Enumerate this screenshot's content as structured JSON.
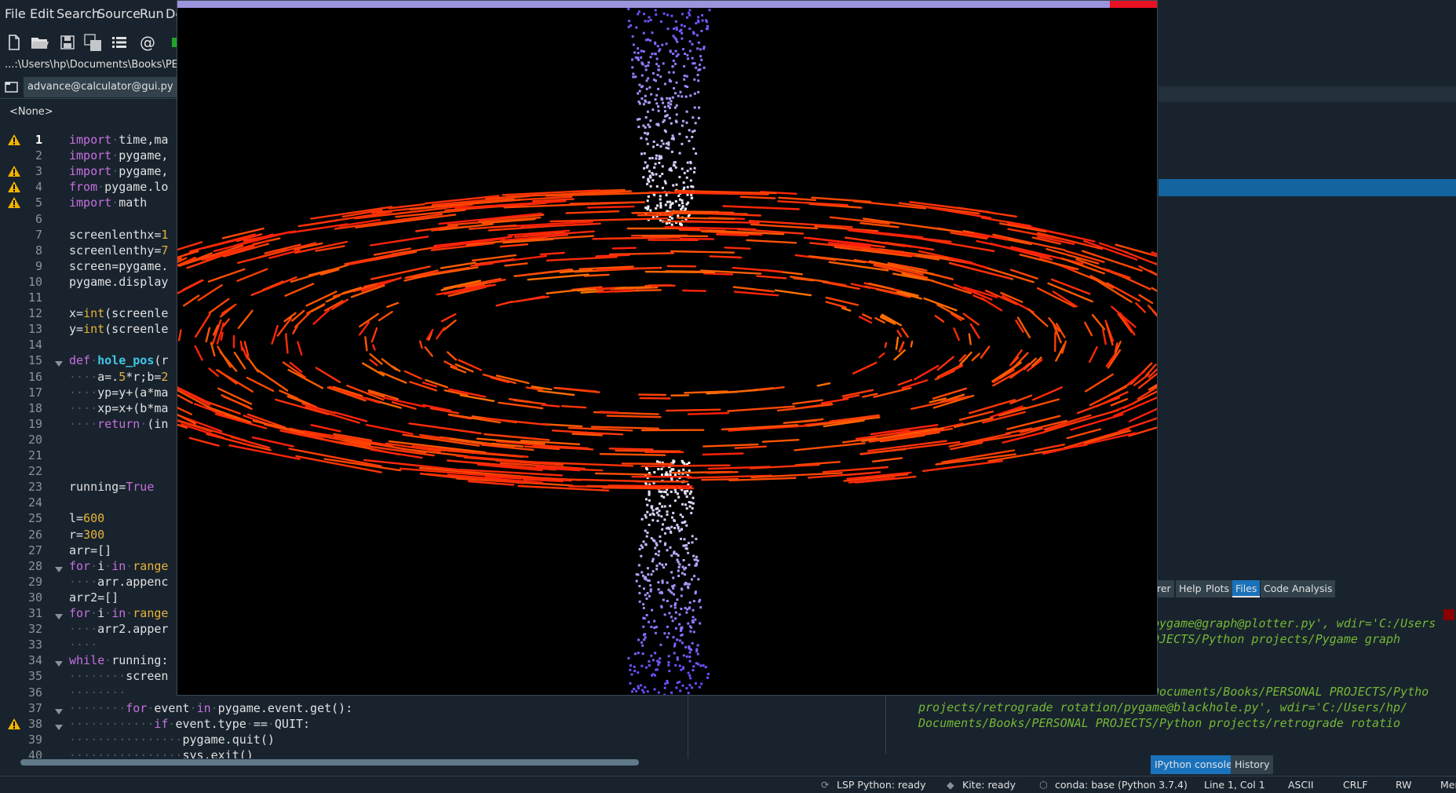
{
  "menu": [
    "File",
    "Edit",
    "Search",
    "Source",
    "Run",
    "De"
  ],
  "toolbar_icons": [
    "new-file-icon",
    "open-file-icon",
    "save-icon",
    "save-all-icon",
    "outline-icon",
    "email-icon",
    "run-icon"
  ],
  "path": "...:\\Users\\hp\\Documents\\Books\\PERSO",
  "editor": {
    "tab_name": "advance@calculator@gui.py",
    "tab_close": "✕",
    "class_selector": "<None>",
    "lines": [
      {
        "n": "1",
        "warn": true,
        "fold": false,
        "html": "<span class='kw'>import</span><span class='ws'>·</span>time,ma"
      },
      {
        "n": "2",
        "warn": false,
        "fold": false,
        "html": "<span class='kw'>import</span><span class='ws'>·</span>pygame,"
      },
      {
        "n": "3",
        "warn": true,
        "fold": false,
        "html": "<span class='kw'>import</span><span class='ws'>·</span>pygame,"
      },
      {
        "n": "4",
        "warn": true,
        "fold": false,
        "html": "<span class='kw'>from</span><span class='ws'>·</span>pygame.lo"
      },
      {
        "n": "5",
        "warn": true,
        "fold": false,
        "html": "<span class='kw'>import</span><span class='ws'>·</span>math"
      },
      {
        "n": "6",
        "warn": false,
        "fold": false,
        "html": ""
      },
      {
        "n": "7",
        "warn": false,
        "fold": false,
        "html": "screenlenthx=<span class='num'>1</span>"
      },
      {
        "n": "8",
        "warn": false,
        "fold": false,
        "html": "screenlenthy=<span class='num'>7</span>"
      },
      {
        "n": "9",
        "warn": false,
        "fold": false,
        "html": "screen=pygame."
      },
      {
        "n": "10",
        "warn": false,
        "fold": false,
        "html": "pygame.display"
      },
      {
        "n": "11",
        "warn": false,
        "fold": false,
        "html": ""
      },
      {
        "n": "12",
        "warn": false,
        "fold": false,
        "html": "x=<span class='bi'>int</span>(screenle"
      },
      {
        "n": "13",
        "warn": false,
        "fold": false,
        "html": "y=<span class='bi'>int</span>(screenle"
      },
      {
        "n": "14",
        "warn": false,
        "fold": false,
        "html": ""
      },
      {
        "n": "15",
        "warn": false,
        "fold": true,
        "html": "<span class='kw'>def</span><span class='ws'>·</span><span class='fn'>hole_pos</span>(r"
      },
      {
        "n": "16",
        "warn": false,
        "fold": false,
        "html": "<span class='ws'>····</span>a=.<span class='num'>5</span>*r;b=<span class='num'>2</span>"
      },
      {
        "n": "17",
        "warn": false,
        "fold": false,
        "html": "<span class='ws'>····</span>yp=y+(a*ma"
      },
      {
        "n": "18",
        "warn": false,
        "fold": false,
        "html": "<span class='ws'>····</span>xp=x+(b*ma"
      },
      {
        "n": "19",
        "warn": false,
        "fold": false,
        "html": "<span class='ws'>····</span><span class='kw'>return</span><span class='ws'>·</span>(in"
      },
      {
        "n": "20",
        "warn": false,
        "fold": false,
        "html": ""
      },
      {
        "n": "21",
        "warn": false,
        "fold": false,
        "html": ""
      },
      {
        "n": "22",
        "warn": false,
        "fold": false,
        "html": ""
      },
      {
        "n": "23",
        "warn": false,
        "fold": false,
        "html": "running=<span class='kw'>True</span>"
      },
      {
        "n": "24",
        "warn": false,
        "fold": false,
        "html": ""
      },
      {
        "n": "25",
        "warn": false,
        "fold": false,
        "html": "l=<span class='num'>600</span>"
      },
      {
        "n": "26",
        "warn": false,
        "fold": false,
        "html": "r=<span class='num'>300</span>"
      },
      {
        "n": "27",
        "warn": false,
        "fold": false,
        "html": "arr=[]"
      },
      {
        "n": "28",
        "warn": false,
        "fold": true,
        "html": "<span class='kw'>for</span><span class='ws'>·</span>i<span class='ws'>·</span><span class='kw'>in</span><span class='ws'>·</span><span class='bi'>range</span>"
      },
      {
        "n": "29",
        "warn": false,
        "fold": false,
        "html": "<span class='ws'>····</span>arr.appenc"
      },
      {
        "n": "30",
        "warn": false,
        "fold": false,
        "html": "arr2=[]"
      },
      {
        "n": "31",
        "warn": false,
        "fold": true,
        "html": "<span class='kw'>for</span><span class='ws'>·</span>i<span class='ws'>·</span><span class='kw'>in</span><span class='ws'>·</span><span class='bi'>range</span>"
      },
      {
        "n": "32",
        "warn": false,
        "fold": false,
        "html": "<span class='ws'>····</span>arr2.apper"
      },
      {
        "n": "33",
        "warn": false,
        "fold": false,
        "html": "<span class='ws'>····</span>"
      },
      {
        "n": "34",
        "warn": false,
        "fold": true,
        "html": "<span class='kw'>while</span><span class='ws'>·</span>running:"
      },
      {
        "n": "35",
        "warn": false,
        "fold": false,
        "html": "<span class='ws'>········</span>screen"
      },
      {
        "n": "36",
        "warn": false,
        "fold": false,
        "html": "<span class='ws'>········</span>"
      },
      {
        "n": "37",
        "warn": false,
        "fold": true,
        "html": "<span class='ws'>········</span><span class='kw'>for</span><span class='ws'>·</span>event<span class='ws'>·</span><span class='kw'>in</span><span class='ws'>·</span>pygame.event.get():"
      },
      {
        "n": "38",
        "warn": true,
        "fold": true,
        "html": "<span class='ws'>············</span><span class='kw'>if</span><span class='ws'>·</span>event.type<span class='ws'>·</span>==<span class='ws'>·</span>QUIT:"
      },
      {
        "n": "39",
        "warn": false,
        "fold": false,
        "html": "<span class='ws'>················</span>pygame.quit()"
      },
      {
        "n": "40",
        "warn": false,
        "fold": false,
        "html": "<span class='ws'>················</span>sys.exit()"
      }
    ]
  },
  "pane_tabs": [
    "rer",
    "Help",
    "Plots",
    "Files",
    "Code Analysis"
  ],
  "pane_tab_active": "Files",
  "console_lines": [
    "pygame@graph@plotter.py', wdir='C:/Users",
    "OJECTS/Python projects/Pygame graph",
    "",
    "",
    "Documents/Books/PERSONAL PROJECTS/Pytho",
    "projects/retrograde rotation/pygame@blackhole.py', wdir='C:/Users/hp/",
    "Documents/Books/PERSONAL PROJECTS/Python projects/retrograde rotatio"
  ],
  "console_tabs": [
    "IPython console",
    "History"
  ],
  "console_tab_active": "IPython console",
  "status": {
    "lsp": "LSP Python: ready",
    "kite": "Kite: ready",
    "conda": "conda: base (Python 3.7.4)",
    "position": "Line 1, Col 1",
    "encoding": "ASCII",
    "eol": "CRLF",
    "permissions": "RW",
    "memory": "Mer"
  },
  "colors": {
    "ide_bg": "#19232d",
    "game_bg": "#000000",
    "game_titlebar": "#9c94dc",
    "close_button": "#e81123",
    "jet_top": "#6a4dff",
    "jet_core": "#ffffff",
    "disk_outer": "#ff1e10",
    "disk_inner": "#ff7a00"
  },
  "game_window": {
    "scene": "black hole accretion disk with vertical relativistic jet",
    "disk_ring_count": 6
  }
}
